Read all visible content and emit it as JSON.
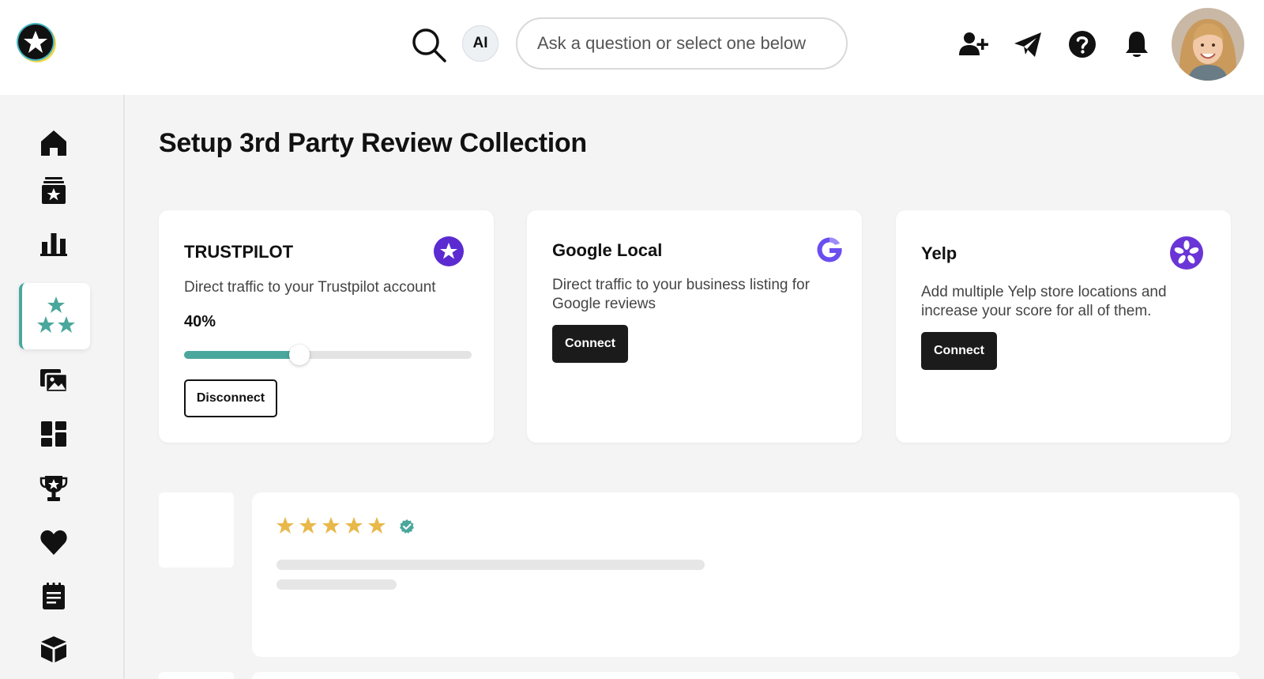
{
  "header": {
    "logo": "star-logo",
    "search_icon": "search-icon",
    "ai_label": "AI",
    "ask_placeholder": "Ask a question or select one below",
    "icons": [
      "add-user-icon",
      "send-icon",
      "help-icon",
      "bell-icon"
    ],
    "avatar": "user-avatar"
  },
  "sidebar": {
    "items": [
      "home-icon",
      "reviews-inbox-icon",
      "analytics-icon",
      "review-collection-icon",
      "media-gallery-icon",
      "dashboard-icon",
      "trophy-icon",
      "heart-icon",
      "notes-icon",
      "package-icon"
    ],
    "active": "review-collection-icon",
    "active_accent": "#4aa79c"
  },
  "page": {
    "title": "Setup 3rd Party Review Collection"
  },
  "cards": {
    "trustpilot": {
      "title": "TRUSTPILOT",
      "description": "Direct traffic to your Trustpilot account",
      "progress_label": "40%",
      "progress_value": 0.4,
      "button": "Disconnect",
      "icon_color": "#5b2bd1"
    },
    "google": {
      "title": "Google Local",
      "description": "Direct traffic to your business listing for Google reviews",
      "button": "Connect",
      "icon_color": "#6a4ef0"
    },
    "yelp": {
      "title": "Yelp",
      "description": "Add multiple Yelp store locations and increase your score for all of them.",
      "button": "Connect",
      "icon_color": "#6a35d6"
    }
  },
  "review_preview": {
    "rating": 5,
    "star_color": "#e8b84a",
    "verified_color": "#4aa79c"
  },
  "colors": {
    "accent": "#4aa79c",
    "dark_button": "#1b1b1b",
    "background": "#f4f4f4"
  }
}
